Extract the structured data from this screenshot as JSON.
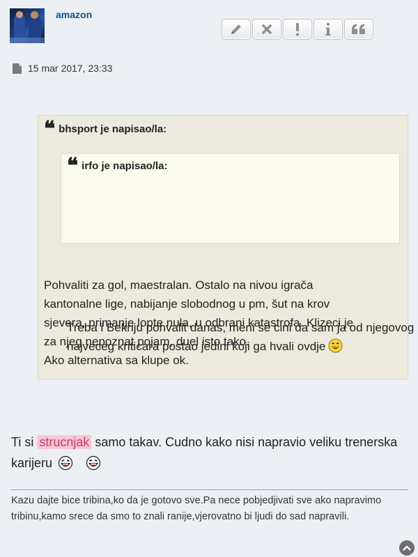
{
  "post": {
    "username": "amazon",
    "date": "15 mar 2017, 23:33",
    "actions": [
      {
        "name": "edit-button",
        "icon": "pencil-icon"
      },
      {
        "name": "delete-button",
        "icon": "close-icon"
      },
      {
        "name": "report-button",
        "icon": "exclamation-icon"
      },
      {
        "name": "info-button",
        "icon": "info-icon"
      },
      {
        "name": "quote-button",
        "icon": "quote-icon"
      }
    ],
    "outer_quote": {
      "author": "bhsport je napisao/la:",
      "inner_quote": {
        "author": "irfo je napisao/la:",
        "text": "Treba i Bekriju pohvalit danas, meni se cini da sam ja od njegovog najveceg kriticara postao jedini koji ga hvali ovdje",
        "smiley": "laughing-smiley-icon"
      },
      "lines": [
        "Pohvaliti za gol, maestralan. Ostalo na nivou igrača",
        "kantonalne lige, nabijanje slobodnog u pm, šut na krov",
        "sjevera, primanje lopte nula, u odbrani katastrofa. Klizeci je",
        "za njeg nepoznat pojam, duel isto tako.",
        "Ako alternativa sa klupe ok."
      ]
    },
    "reply": {
      "before": "Ti si ",
      "highlight": "strucnjak",
      "after": " samo takav. Cudno kako nisi napravio veliku trenerska karijeru",
      "smileys": [
        "laughing-face-icon",
        "laughing-face-icon"
      ]
    },
    "signature": "Kazu dajte bice tribina,ko da je gotovo sve.Pa nece pobjedjivati sve ako napravimo tribinu,kamo srece da smo to znali ranije,vjerovatno bi ljudi do sad napravili."
  },
  "colors": {
    "username": "#105289",
    "quote_bg": "#ebeadd",
    "nested_quote_bg": "#fbfbed",
    "highlight_bg": "#f6c7d5",
    "highlight_text": "#c73b6b"
  }
}
